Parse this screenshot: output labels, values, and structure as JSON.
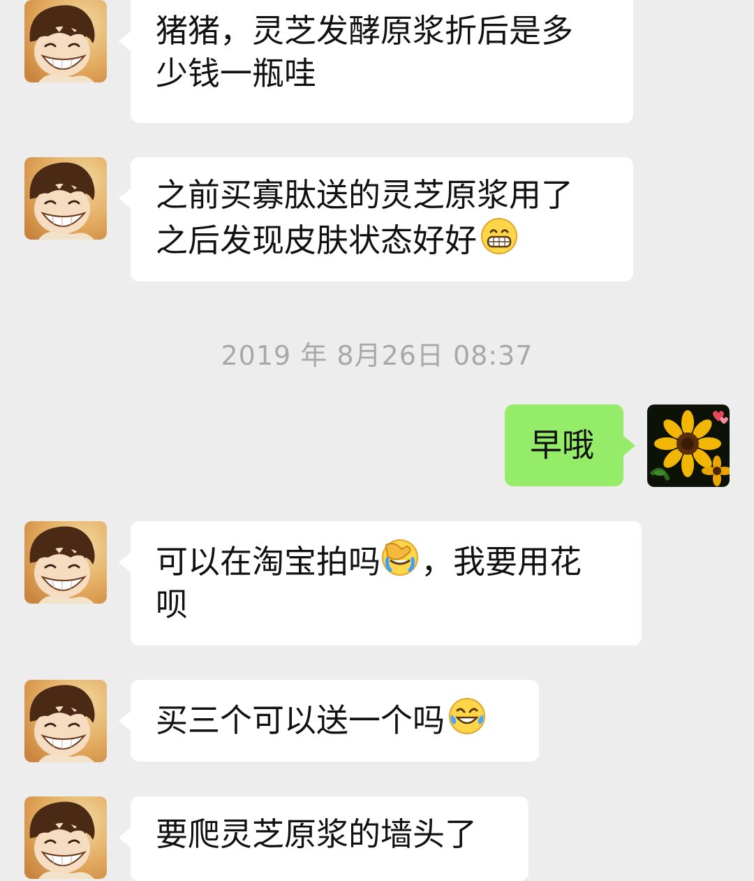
{
  "conversation": {
    "timestamp": "2019 年 8月26日 08:37",
    "messages": [
      {
        "sender": "contact",
        "avatar": "cartoon-boy-avatar",
        "line1": "猪猪，灵芝发酵原浆折后是多",
        "line2": "少钱一瓶哇"
      },
      {
        "sender": "contact",
        "avatar": "cartoon-boy-avatar",
        "line1": "之前买寡肽送的灵芝原浆用了",
        "line2": "之后发现皮肤状态好好",
        "emoji": "grinning-face"
      },
      {
        "sender": "me",
        "avatar": "sunflower-avatar",
        "line1": "早哦"
      },
      {
        "sender": "contact",
        "avatar": "cartoon-boy-avatar",
        "line1a": "可以在淘宝拍吗",
        "emoji": "face-palm",
        "line1b": "，我要用花",
        "line2": "呗"
      },
      {
        "sender": "contact",
        "avatar": "cartoon-boy-avatar",
        "line1": "买三个可以送一个吗",
        "emoji": "tears-of-joy"
      },
      {
        "sender": "contact",
        "avatar": "cartoon-boy-avatar",
        "line1": "要爬灵芝原浆的墙头了"
      }
    ]
  },
  "colors": {
    "background": "#ededed",
    "incoming_bubble": "#ffffff",
    "outgoing_bubble": "#95ec69",
    "timestamp_text": "#a8a8a8"
  }
}
